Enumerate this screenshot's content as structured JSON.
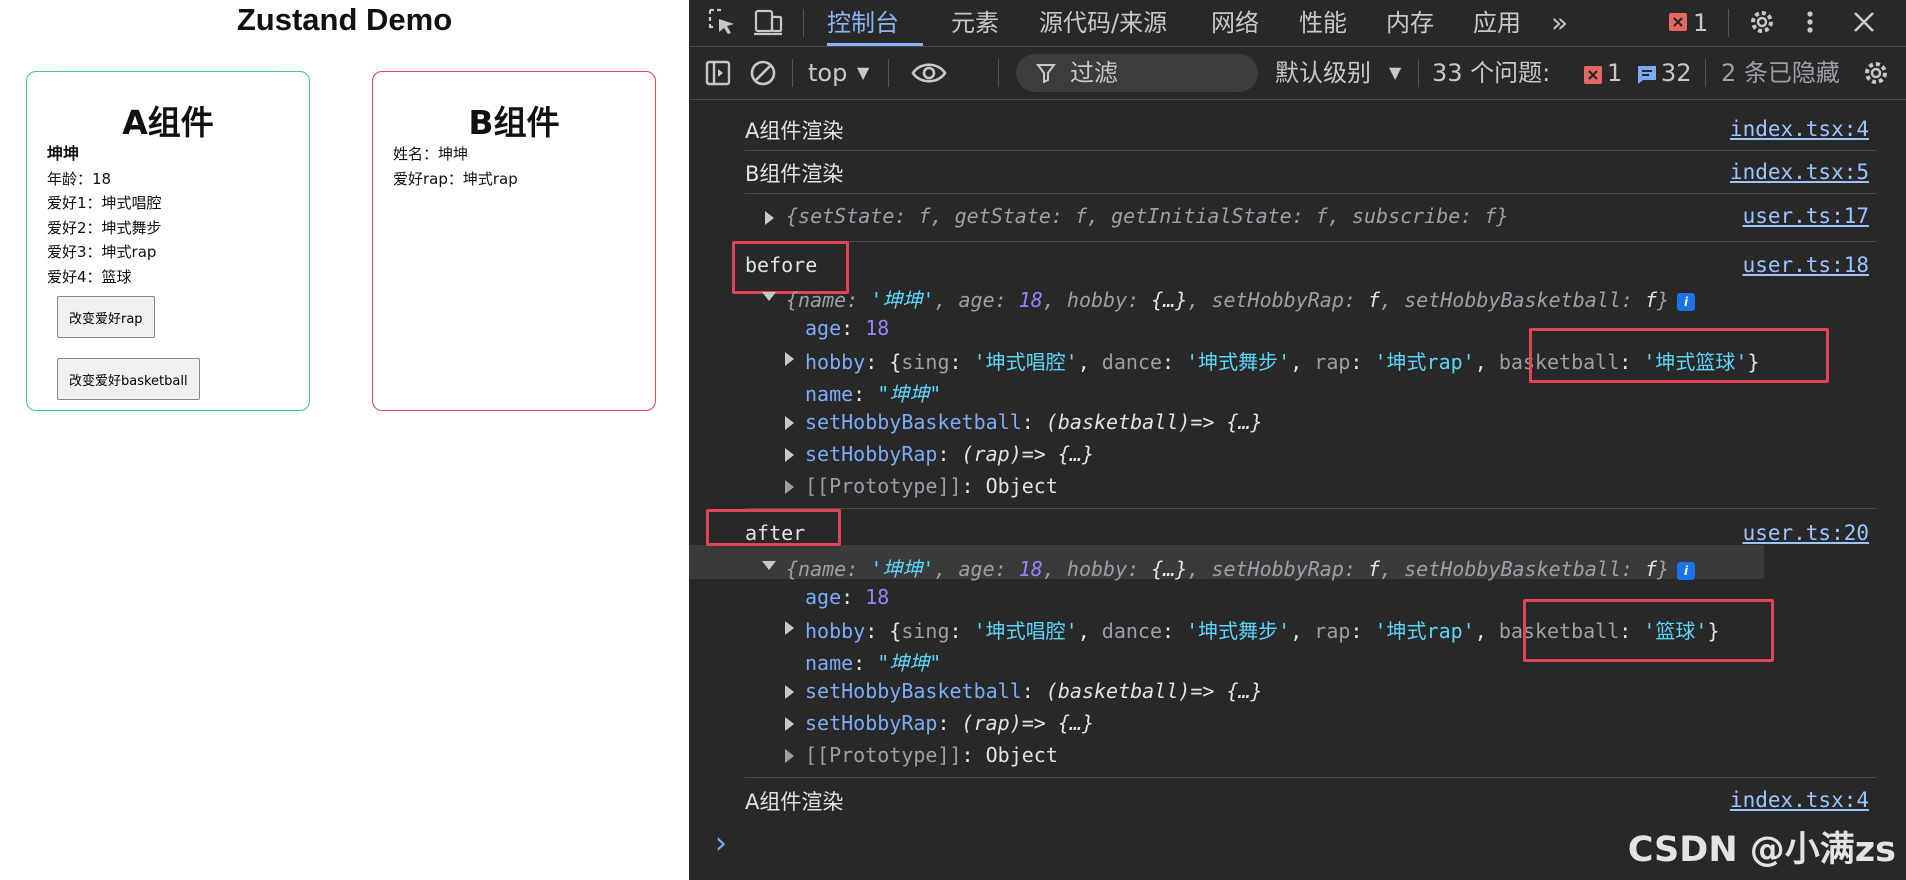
{
  "app": {
    "title": "Zustand Demo",
    "card_a": {
      "heading": "A组件",
      "name": "坤坤",
      "age_line": "年龄：18",
      "hobby1": "爱好1：坤式唱腔",
      "hobby2": "爱好2：坤式舞步",
      "hobby3": "爱好3：坤式rap",
      "hobby4": "爱好4：篮球",
      "btn_rap": "改变爱好rap",
      "btn_basketball": "改变爱好basketball"
    },
    "card_b": {
      "heading": "B组件",
      "name_line": "姓名：坤坤",
      "rap_line": "爱好rap：坤式rap"
    }
  },
  "devtools": {
    "tabs": [
      "控制台",
      "元素",
      "源代码/来源",
      "网络",
      "性能",
      "内存",
      "应用"
    ],
    "more": "»",
    "error_count": "1",
    "toolbar": {
      "context": "top",
      "filter_placeholder": "过滤",
      "level": "默认级别",
      "issues_label": "33 个问题:",
      "issues_errors": "1",
      "issues_info": "32",
      "hidden": "2 条已隐藏"
    },
    "console": [
      {
        "text": "A组件渲染",
        "source": "index.tsx:4"
      },
      {
        "text": "B组件渲染",
        "source": "index.tsx:5"
      },
      {
        "text": "{setState: f, getState: f, getInitialState: f, subscribe: f}",
        "source": "user.ts:17"
      },
      {
        "text": "before",
        "source": "user.ts:18"
      },
      {
        "text": "after",
        "source": "user.ts:20"
      },
      {
        "text": "A组件渲染",
        "source": "index.tsx:4"
      }
    ],
    "obj_summary": {
      "name_k": "name",
      "name_v": "'坤坤'",
      "age_k": "age",
      "age_v": "18",
      "hobby_k": "hobby",
      "hobby_v": "{…}",
      "rap_k": "setHobbyRap",
      "f": "f",
      "bb_k": "setHobbyBasketball"
    },
    "props": {
      "age_k": "age",
      "age_v": "18",
      "hobby_k": "hobby",
      "sing_k": "sing",
      "sing_v": "'坤式唱腔'",
      "dance_k": "dance",
      "dance_v": "'坤式舞步'",
      "rap_k": "rap",
      "rap_v": "'坤式rap'",
      "bb_k": "basketball",
      "bb_before": "'坤式篮球'",
      "bb_after": "'篮球'",
      "name_k": "name",
      "name_v": "\"坤坤\"",
      "setbb_k": "setHobbyBasketball",
      "setbb_v": "(basketball)=> {…}",
      "setrap_k": "setHobbyRap",
      "setrap_v": "(rap)=> {…}",
      "proto_k": "[[Prototype]]",
      "proto_v": "Object"
    },
    "prompt": "›",
    "watermark": "CSDN @小满zs"
  }
}
